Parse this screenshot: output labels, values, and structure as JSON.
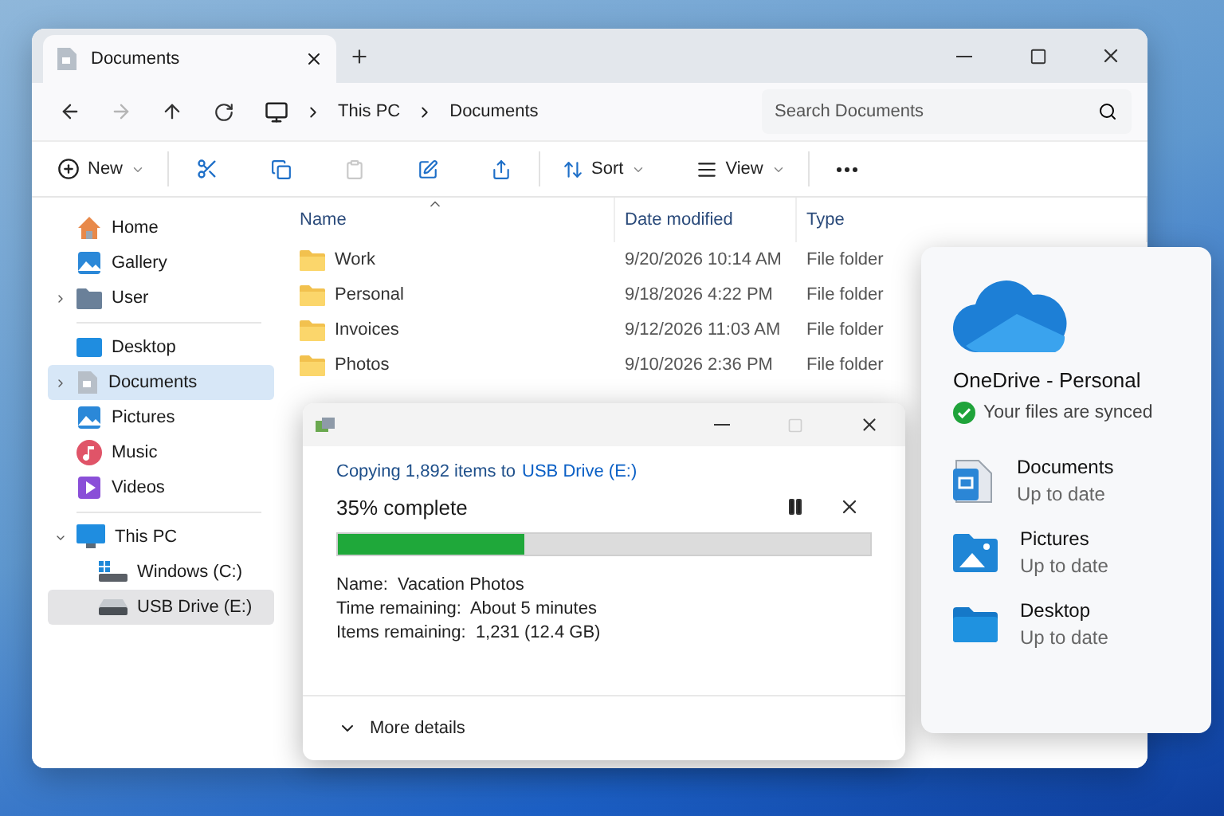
{
  "window": {
    "tab": {
      "title": "Documents"
    }
  },
  "address_bar": {
    "path": [
      "This PC",
      "Documents"
    ],
    "search": {
      "placeholder": "Search Documents"
    }
  },
  "nav": {
    "forward_disabled": true
  },
  "toolbar": {
    "new": "New",
    "paste_disabled": true,
    "sort": "Sort",
    "view": "View"
  },
  "sidebar": {
    "groups": [
      {
        "items": [
          {
            "label": "Home",
            "selected": false
          },
          {
            "label": "Gallery",
            "selected": false
          },
          {
            "label": "User",
            "selected": false,
            "expanded": false
          }
        ]
      },
      {
        "items": [
          {
            "label": "Desktop",
            "selected": false
          },
          {
            "label": "Documents",
            "selected": true,
            "expanded": false
          },
          {
            "label": "Pictures",
            "selected": false
          },
          {
            "label": "Music",
            "selected": false
          },
          {
            "label": "Videos",
            "selected": false
          }
        ]
      },
      {
        "items": [
          {
            "label": "This PC",
            "selected": false,
            "expanded": true,
            "children": [
              {
                "label": "Windows (C:)",
                "selected": false
              },
              {
                "label": "USB Drive (E:)",
                "selected": true
              }
            ]
          }
        ]
      }
    ]
  },
  "file_list": {
    "columns": [
      "Name",
      "Date modified",
      "Type"
    ],
    "rows": [
      {
        "name": "Work",
        "date": "9/20/2026 10:14 AM",
        "type": "File folder"
      },
      {
        "name": "Personal",
        "date": "9/18/2026 4:22 PM",
        "type": "File folder"
      },
      {
        "name": "Invoices",
        "date": "9/12/2026 11:03 AM",
        "type": "File folder"
      },
      {
        "name": "Photos",
        "date": "9/10/2026 2:36 PM",
        "type": "File folder"
      }
    ]
  },
  "copy_dialog": {
    "heading": "Copying 1,892 items to",
    "destination": "USB Drive (E:)",
    "progress_text": "35% complete",
    "level": 0.35,
    "maximize_disabled": true,
    "details": [
      {
        "label": "Name:",
        "value": "Vacation Photos"
      },
      {
        "label": "Time remaining:",
        "value": "About 5 minutes"
      },
      {
        "label": "Items remaining:",
        "value": "1,231 (12.4 GB)"
      }
    ],
    "more": "More details"
  },
  "onedrive": {
    "title": "OneDrive - Personal",
    "status": "Your files are synced",
    "folders": [
      {
        "name": "Documents",
        "status": "Up to date"
      },
      {
        "name": "Pictures",
        "status": "Up to date"
      },
      {
        "name": "Desktop",
        "status": "Up to date"
      }
    ]
  }
}
